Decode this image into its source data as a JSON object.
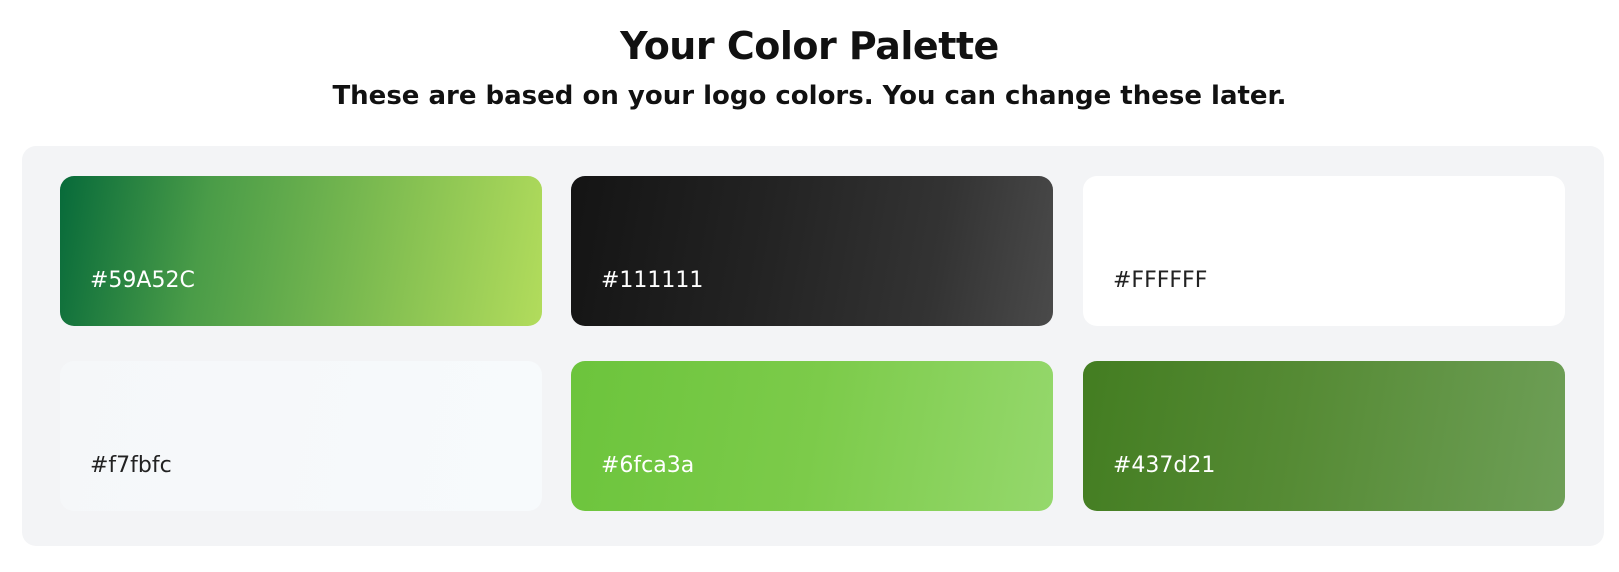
{
  "header": {
    "title": "Your Color Palette",
    "subtitle": "These are based on your logo colors. You can change these later."
  },
  "palette": {
    "swatches": [
      {
        "hex": "#59A52C",
        "color": "#59A52C"
      },
      {
        "hex": "#111111",
        "color": "#111111"
      },
      {
        "hex": "#FFFFFF",
        "color": "#FFFFFF"
      },
      {
        "hex": "#f7fbfc",
        "color": "#f7fbfc"
      },
      {
        "hex": "#6fca3a",
        "color": "#6fca3a"
      },
      {
        "hex": "#437d21",
        "color": "#437d21"
      }
    ]
  }
}
